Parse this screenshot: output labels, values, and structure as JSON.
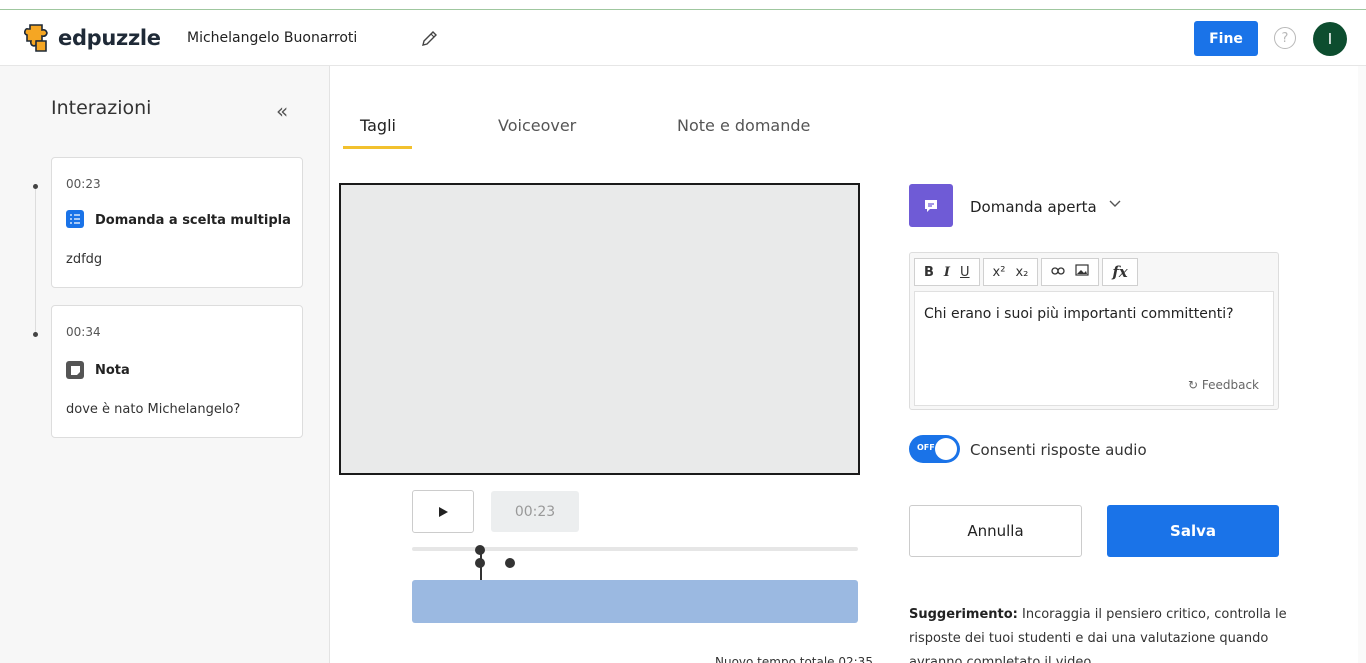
{
  "app": {
    "brand": "edpuzzle",
    "video_title": "Michelangelo Buonarroti",
    "finish_label": "Fine",
    "help_symbol": "?",
    "avatar_initial": "I",
    "accent_color": "#1a73e8"
  },
  "sidebar": {
    "title": "Interazioni",
    "collapse_symbol": "«",
    "items": [
      {
        "time": "00:23",
        "type_label": "Domanda a scelta multipla",
        "icon": "multiple-choice-icon",
        "description": "zdfdg"
      },
      {
        "time": "00:34",
        "type_label": "Nota",
        "icon": "note-icon",
        "description": "dove è nato Michelangelo?"
      }
    ]
  },
  "tabs": [
    {
      "label": "Tagli",
      "active": true
    },
    {
      "label": "Voiceover",
      "active": false
    },
    {
      "label": "Note e domande",
      "active": false
    }
  ],
  "player": {
    "current_time": "00:23",
    "total_time": "Nuovo tempo totale 02:35"
  },
  "question_panel": {
    "type_label": "Domanda aperta",
    "toolbar": [
      "B",
      "I",
      "U",
      "x²",
      "x₂",
      "link",
      "image",
      "fx"
    ],
    "question_text": "Chi erano i suoi più importanti committenti?",
    "feedback_label": "Feedback",
    "toggle_state": "OFF",
    "toggle_label": "Consenti risposte audio",
    "cancel_label": "Annulla",
    "save_label": "Salva",
    "tip_title": "Suggerimento:",
    "tip_text": " Incoraggia il pensiero critico, controlla le risposte dei tuoi studenti e dai una valutazione quando avranno completato il video."
  }
}
